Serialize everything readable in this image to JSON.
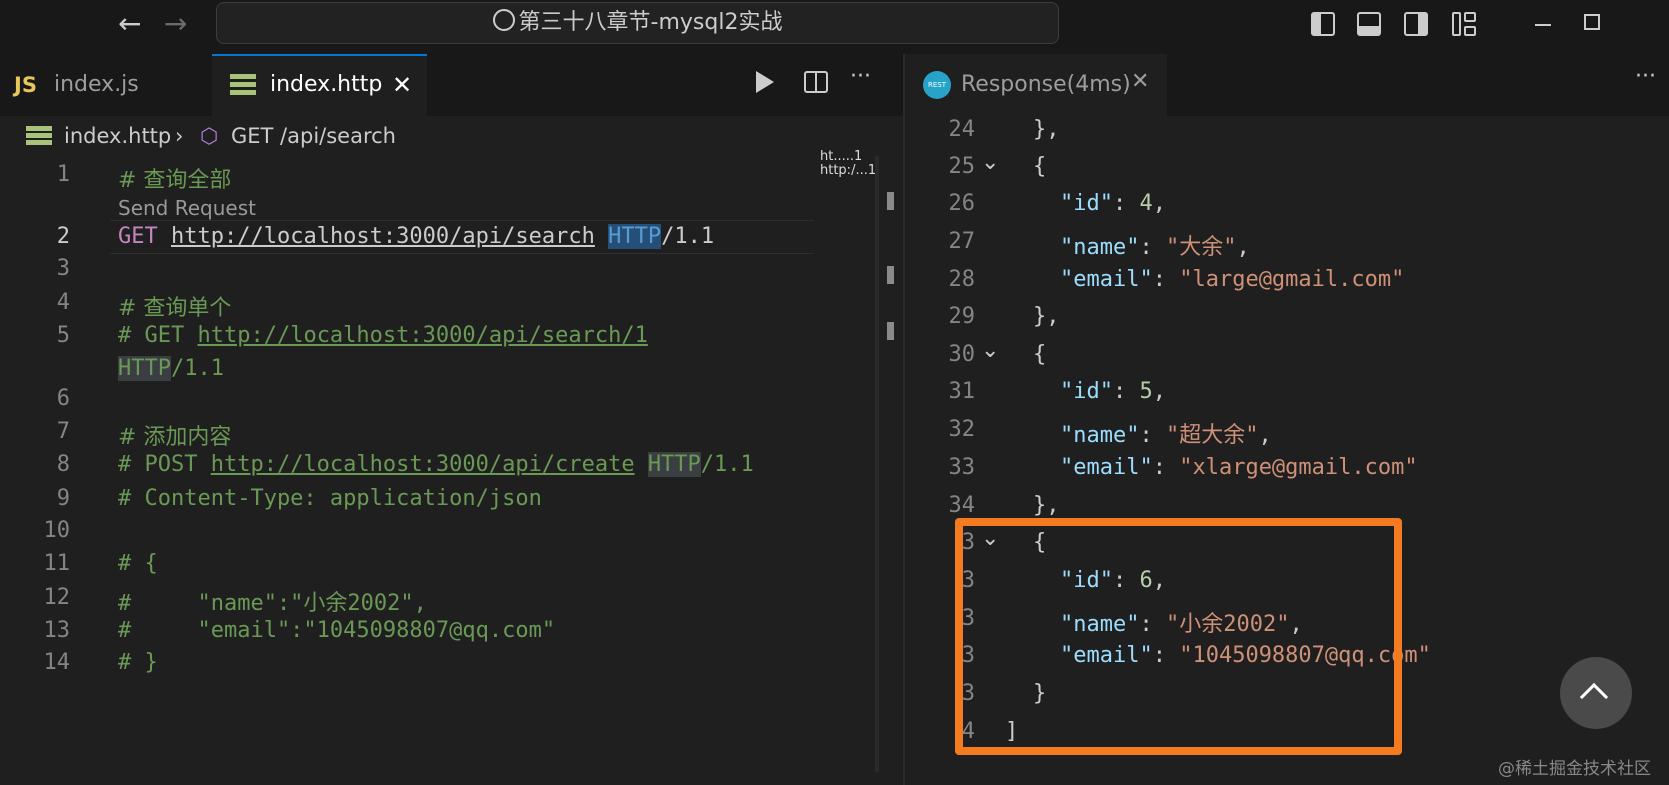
{
  "titlebar": {
    "search_text": "第三十八章节-mysql2实战"
  },
  "left_tabs": [
    {
      "icon_text": "JS",
      "label": "index.js"
    },
    {
      "label": "index.http"
    }
  ],
  "breadcrumb": {
    "file": "index.http",
    "symbol": "GET /api/search"
  },
  "codelens": "Send Request",
  "minimap": {
    "line1": "ht.....1",
    "line2": "http:/...1"
  },
  "editor": {
    "line_numbers": [
      "1",
      "2",
      "3",
      "4",
      "5",
      "6",
      "7",
      "8",
      "9",
      "10",
      "11",
      "12",
      "13",
      "14"
    ],
    "l1": "# 查询全部",
    "l2_method": "GET",
    "l2_url": "http://localhost:3000/api/search",
    "l2_http": "HTTP",
    "l2_ver": "/1.1",
    "l4": "# 查询单个",
    "l5_prefix": "# GET ",
    "l5_url": "http://localhost:3000/api/search/1",
    "l5b_http": "HTTP",
    "l5b_ver": "/1.1",
    "l7": "# 添加内容",
    "l8_prefix": "# POST ",
    "l8_url": "http://localhost:3000/api/create",
    "l8_http": "HTTP",
    "l8_ver": "/1.1",
    "l9": "# Content-Type: application/json",
    "l11": "# {",
    "l12": "#     \"name\":\"小余2002\",",
    "l13": "#     \"email\":\"1045098807@qq.com\"",
    "l14": "# }"
  },
  "response_tab": {
    "icon_text": "REST",
    "label": "Response(4ms)"
  },
  "response": {
    "line_numbers": [
      "24",
      "25",
      "26",
      "27",
      "28",
      "29",
      "30",
      "31",
      "32",
      "33",
      "34",
      "3",
      "3",
      "3",
      "3",
      "3",
      "4"
    ],
    "r24": "},",
    "r25": "{",
    "r26_key": "\"id\"",
    "r26_val": "4",
    "r27_key": "\"name\"",
    "r27_val": "\"大余\"",
    "r28_key": "\"email\"",
    "r28_val": "\"large@gmail.com\"",
    "r29": "},",
    "r30": "{",
    "r31_key": "\"id\"",
    "r31_val": "5",
    "r32_key": "\"name\"",
    "r32_val": "\"超大余\"",
    "r33_key": "\"email\"",
    "r33_val": "\"xlarge@gmail.com\"",
    "r34": "},",
    "r35": "{",
    "r36_key": "\"id\"",
    "r36_val": "6",
    "r37_key": "\"name\"",
    "r37_val": "\"小余2002\"",
    "r38_key": "\"email\"",
    "r38_val": "\"1045098807@qq.com\"",
    "r39": "}",
    "r40": "]"
  },
  "watermark": "@稀土掘金技术社区",
  "colors": {
    "highlight_box": "#f47b20",
    "comment": "#6a9955",
    "string": "#ce9178",
    "key": "#9cdcfe",
    "number": "#b5cea8"
  }
}
